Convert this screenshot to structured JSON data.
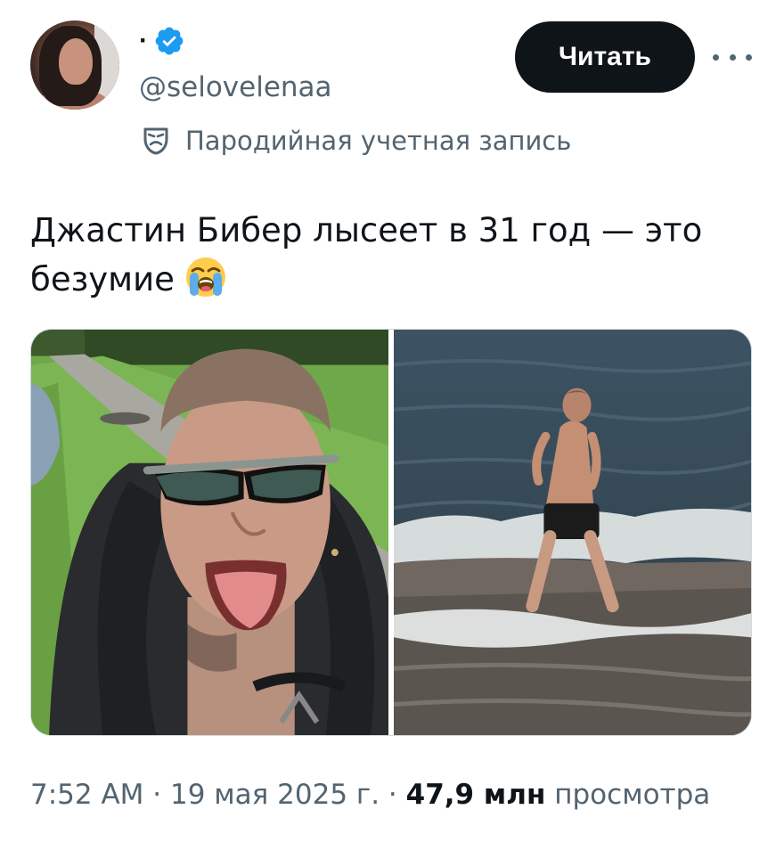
{
  "author": {
    "display_name": "·",
    "handle": "@selovelenaa",
    "verified_color": "#1d9bf0",
    "parody_label": "Пародийная учетная запись",
    "parody_icon": "mask-icon"
  },
  "actions": {
    "follow_label": "Читать",
    "more_icon": "more-horizontal-icon"
  },
  "tweet": {
    "text": "Джастин Бибер лысеет в 31 год — это безумие",
    "emoji": "loudly-crying-face"
  },
  "media": {
    "count": 2,
    "photos": [
      {
        "name": "photo-1"
      },
      {
        "name": "photo-2"
      }
    ]
  },
  "meta": {
    "time": "7:52 AM",
    "separator": " · ",
    "date": "19 мая 2025 г.",
    "views_count": "47,9 млн",
    "views_label": "просмотра"
  },
  "colors": {
    "text_primary": "#0f1419",
    "text_secondary": "#536471",
    "verified": "#1d9bf0",
    "button_bg": "#0f1419",
    "button_text": "#ffffff"
  }
}
